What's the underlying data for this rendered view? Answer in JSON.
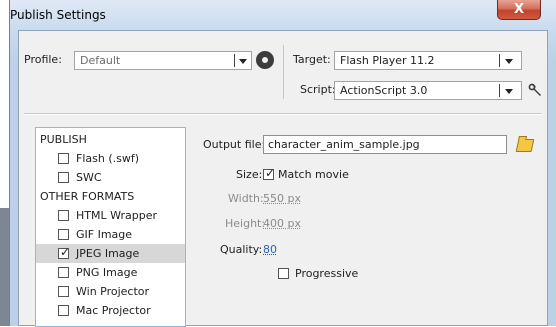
{
  "window": {
    "title": "Publish Settings",
    "close_glyph": "X"
  },
  "profile": {
    "label": "Profile:",
    "value": "Default"
  },
  "target": {
    "label": "Target:",
    "value": "Flash Player 11.2"
  },
  "script": {
    "label": "Script:",
    "value": "ActionScript 3.0"
  },
  "icons": {
    "profile_options": "gear-icon",
    "script_settings": "wrench-icon",
    "browse": "folder-icon",
    "dropdown": "chevron-down-icon"
  },
  "publish_list": {
    "publish_header": "PUBLISH",
    "publish_items": [
      {
        "label": "Flash (.swf)",
        "checked": false
      },
      {
        "label": "SWC",
        "checked": false
      }
    ],
    "other_header": "OTHER FORMATS",
    "other_items": [
      {
        "label": "HTML Wrapper",
        "checked": false
      },
      {
        "label": "GIF Image",
        "checked": false
      },
      {
        "label": "JPEG Image",
        "checked": true,
        "selected": true
      },
      {
        "label": "PNG Image",
        "checked": false
      },
      {
        "label": "Win Projector",
        "checked": false
      },
      {
        "label": "Mac Projector",
        "checked": false
      }
    ]
  },
  "jpeg": {
    "output_label": "Output file:",
    "output_value": "character_anim_sample.jpg",
    "size_label": "Size:",
    "match_movie_label": "Match movie",
    "match_movie_checked": true,
    "width_label": "Width:",
    "width_value": "550 px",
    "height_label": "Height:",
    "height_value": "400 px",
    "quality_label": "Quality:",
    "quality_value": "80",
    "progressive_label": "Progressive",
    "progressive_checked": false
  },
  "colors": {
    "title_bar": "#c9dbee",
    "close_button": "#c2432b",
    "list_border": "#95b6d6",
    "selected_row": "#d7d7d7",
    "link_blue": "#2a62b8"
  }
}
